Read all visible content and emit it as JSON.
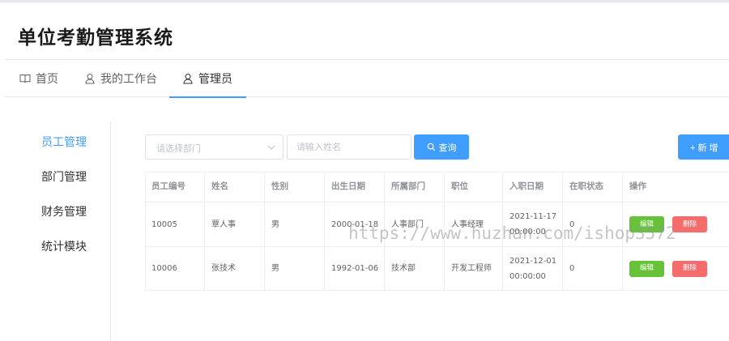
{
  "app": {
    "title": "单位考勤管理系统"
  },
  "nav": {
    "tabs": [
      {
        "label": "首页",
        "icon": "book-icon"
      },
      {
        "label": "我的工作台",
        "icon": "user-icon"
      },
      {
        "label": "管理员",
        "icon": "user-icon",
        "active": true
      }
    ]
  },
  "sidebar": {
    "items": [
      {
        "label": "员工管理",
        "active": true
      },
      {
        "label": "部门管理"
      },
      {
        "label": "财务管理"
      },
      {
        "label": "统计模块"
      }
    ]
  },
  "filters": {
    "department_placeholder": "请选择部门",
    "name_placeholder": "请输入姓名",
    "query_label": "查询",
    "add_label": "+ 新 增"
  },
  "table": {
    "columns": [
      "员工编号",
      "姓名",
      "性别",
      "出生日期",
      "所属部门",
      "职位",
      "入职日期",
      "在职状态",
      "操作"
    ],
    "rows": [
      {
        "id": "10005",
        "name": "覃人事",
        "gender": "男",
        "birth": "2000-01-18",
        "dept": "人事部门",
        "position": "人事经理",
        "hire_date": "2021-11-17",
        "hire_time": "00:00:00",
        "status": "0"
      },
      {
        "id": "10006",
        "name": "张技术",
        "gender": "男",
        "birth": "1992-01-06",
        "dept": "技术部",
        "position": "开发工程师",
        "hire_date": "2021-12-01",
        "hire_time": "00:00:00",
        "status": "0"
      }
    ],
    "edit_label": "编辑",
    "delete_label": "删除"
  },
  "watermark": "https://www.huzhan.com/ishop3572",
  "colors": {
    "primary": "#409eff",
    "success": "#67c23a",
    "danger": "#f56c6c"
  }
}
